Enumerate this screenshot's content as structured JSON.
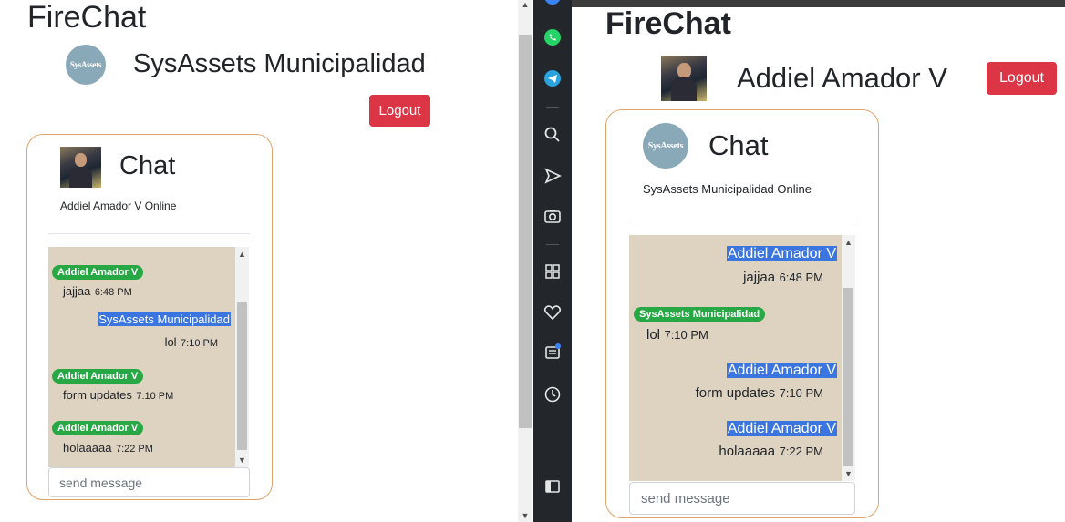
{
  "left": {
    "app_title": "FireChat",
    "user_logo_text": "SysAssets",
    "user_name": "SysAssets Municipalidad",
    "logout_label": "Logout",
    "chat": {
      "title": "Chat",
      "status": "Addiel Amador V Online",
      "messages": [
        {
          "sender": "Addiel Amador V",
          "text": "jajjaa",
          "time": "6:48 PM"
        },
        {
          "sender": "SysAssets Municipalidad",
          "text": "lol",
          "time": "7:10 PM"
        },
        {
          "sender": "Addiel Amador V",
          "text": "form updates",
          "time": "7:10 PM"
        },
        {
          "sender": "Addiel Amador V",
          "text": "holaaaaa",
          "time": "7:22 PM"
        }
      ],
      "input_placeholder": "send message"
    }
  },
  "right": {
    "app_title": "FireChat",
    "user_name": "Addiel Amador V",
    "logout_label": "Logout",
    "chat": {
      "logo_text": "SysAssets",
      "title": "Chat",
      "status": "SysAssets Municipalidad Online",
      "messages": [
        {
          "sender": "Addiel Amador V",
          "text": "jajjaa",
          "time": "6:48 PM"
        },
        {
          "sender": "SysAssets Municipalidad",
          "text": "lol",
          "time": "7:10 PM"
        },
        {
          "sender": "Addiel Amador V",
          "text": "form updates",
          "time": "7:10 PM"
        },
        {
          "sender": "Addiel Amador V",
          "text": "holaaaaa",
          "time": "7:22 PM"
        }
      ],
      "input_placeholder": "send message"
    }
  },
  "dock": {
    "icons": [
      "messenger-icon",
      "whatsapp-icon",
      "telegram-icon",
      "search-icon",
      "send-icon",
      "camera-icon",
      "apps-grid-icon",
      "heart-icon",
      "news-icon",
      "history-icon",
      "sidebar-toggle-icon"
    ],
    "colors": {
      "whatsapp": "#25d366",
      "telegram": "#2aa3df",
      "messenger": "#3b82f6",
      "notification": "#3b82f6"
    }
  },
  "colors": {
    "logout": "#dc3545",
    "badge": "#28a745",
    "chat_bg": "#ded2c1",
    "card_border": "#e0a46a",
    "selection": "#3b75e0"
  }
}
